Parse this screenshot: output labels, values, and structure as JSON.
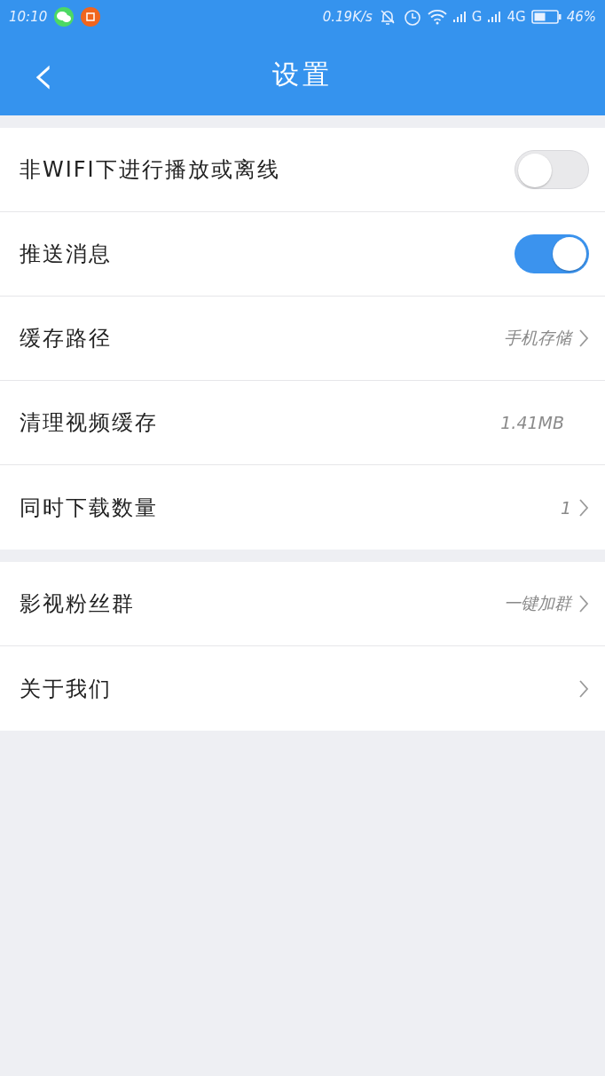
{
  "status_bar": {
    "time": "10:10",
    "speed": "0.19K/s",
    "network_1": "G",
    "network_2": "4G",
    "battery": "46%"
  },
  "header": {
    "title": "设置",
    "back": "‹"
  },
  "groups": [
    {
      "rows": [
        {
          "kind": "toggle",
          "label": "非WIFI下进行播放或离线",
          "on": false
        },
        {
          "kind": "toggle",
          "label": "推送消息",
          "on": true
        },
        {
          "kind": "link",
          "label": "缓存路径",
          "value": "手机存储"
        },
        {
          "kind": "value",
          "label": "清理视频缓存",
          "value": "1.41MB"
        },
        {
          "kind": "link",
          "label": "同时下载数量",
          "value": "1"
        }
      ]
    },
    {
      "rows": [
        {
          "kind": "link",
          "label": "影视粉丝群",
          "value": "一键加群"
        },
        {
          "kind": "link",
          "label": "关于我们"
        }
      ]
    }
  ]
}
